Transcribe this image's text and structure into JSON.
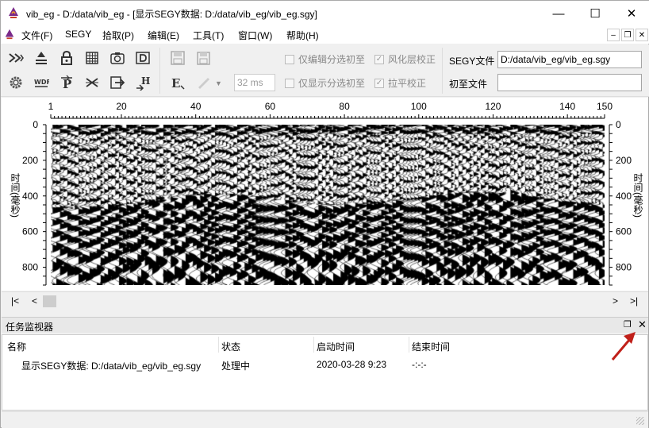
{
  "window": {
    "title": "vib_eg - D:/data/vib_eg - [显示SEGY数据: D:/data/vib_eg/vib_eg.sgy]",
    "minimize_glyph": "—",
    "maximize_glyph": "☐",
    "close_glyph": "✕"
  },
  "menu": {
    "items": [
      "文件(F)",
      "SEGY",
      "拾取(P)",
      "编辑(E)",
      "工具(T)",
      "窗口(W)",
      "帮助(H)"
    ],
    "mdi_minimize": "–",
    "mdi_restore": "❐",
    "mdi_close": "✕"
  },
  "toolbar": {
    "row1_icons": [
      "fast-forward-icon",
      "pick-icon",
      "lock-icon",
      "grid-icon",
      "camera-icon",
      "d-icon"
    ],
    "row2_icons": [
      "gear-icon",
      "wdf-icon",
      "p-icon",
      "scissors-icon",
      "export-icon",
      "h-icon"
    ],
    "save_icons": [
      "save-icon",
      "save-all-icon"
    ],
    "edit_icons": [
      "e-edit-icon",
      "pen-icon",
      "dropdown-arrow-icon"
    ],
    "ms_value": "32 ms",
    "check1": "仅编辑分选初至",
    "check2": "风化层校正",
    "check3": "仅显示分选初至",
    "check4": "拉平校正",
    "check2_mark": "✓",
    "check4_mark": "✓",
    "segy_label": "SEGY文件",
    "segy_value": "D:/data/vib_eg/vib_eg.sgy",
    "firstbreak_label": "初至文件",
    "firstbreak_value": ""
  },
  "plot": {
    "x_ticks": [
      "1",
      "20",
      "40",
      "60",
      "80",
      "100",
      "120",
      "140",
      "150"
    ],
    "y_ticks": [
      "0",
      "200",
      "400",
      "600",
      "800"
    ],
    "y_label_left": "时间(毫秒)",
    "y_label_right": "时间(毫秒)",
    "trace_count": 150,
    "time_max_ms": 900
  },
  "scrollbar": {
    "first": "|<",
    "prev": "<",
    "next": ">",
    "last": ">|"
  },
  "task_monitor": {
    "title": "任务监视器",
    "restore_glyph": "❐",
    "close_glyph": "✕",
    "columns": [
      "名称",
      "状态",
      "启动时间",
      "结束时间"
    ],
    "rows": [
      {
        "name": "显示SEGY数据: D:/data/vib_eg/vib_eg.sgy",
        "status": "处理中",
        "start": "2020-03-28 9:23",
        "end": "-:-:-"
      }
    ]
  },
  "colors": {
    "annotation_arrow": "#c0201a",
    "accent": "#0078d7"
  }
}
